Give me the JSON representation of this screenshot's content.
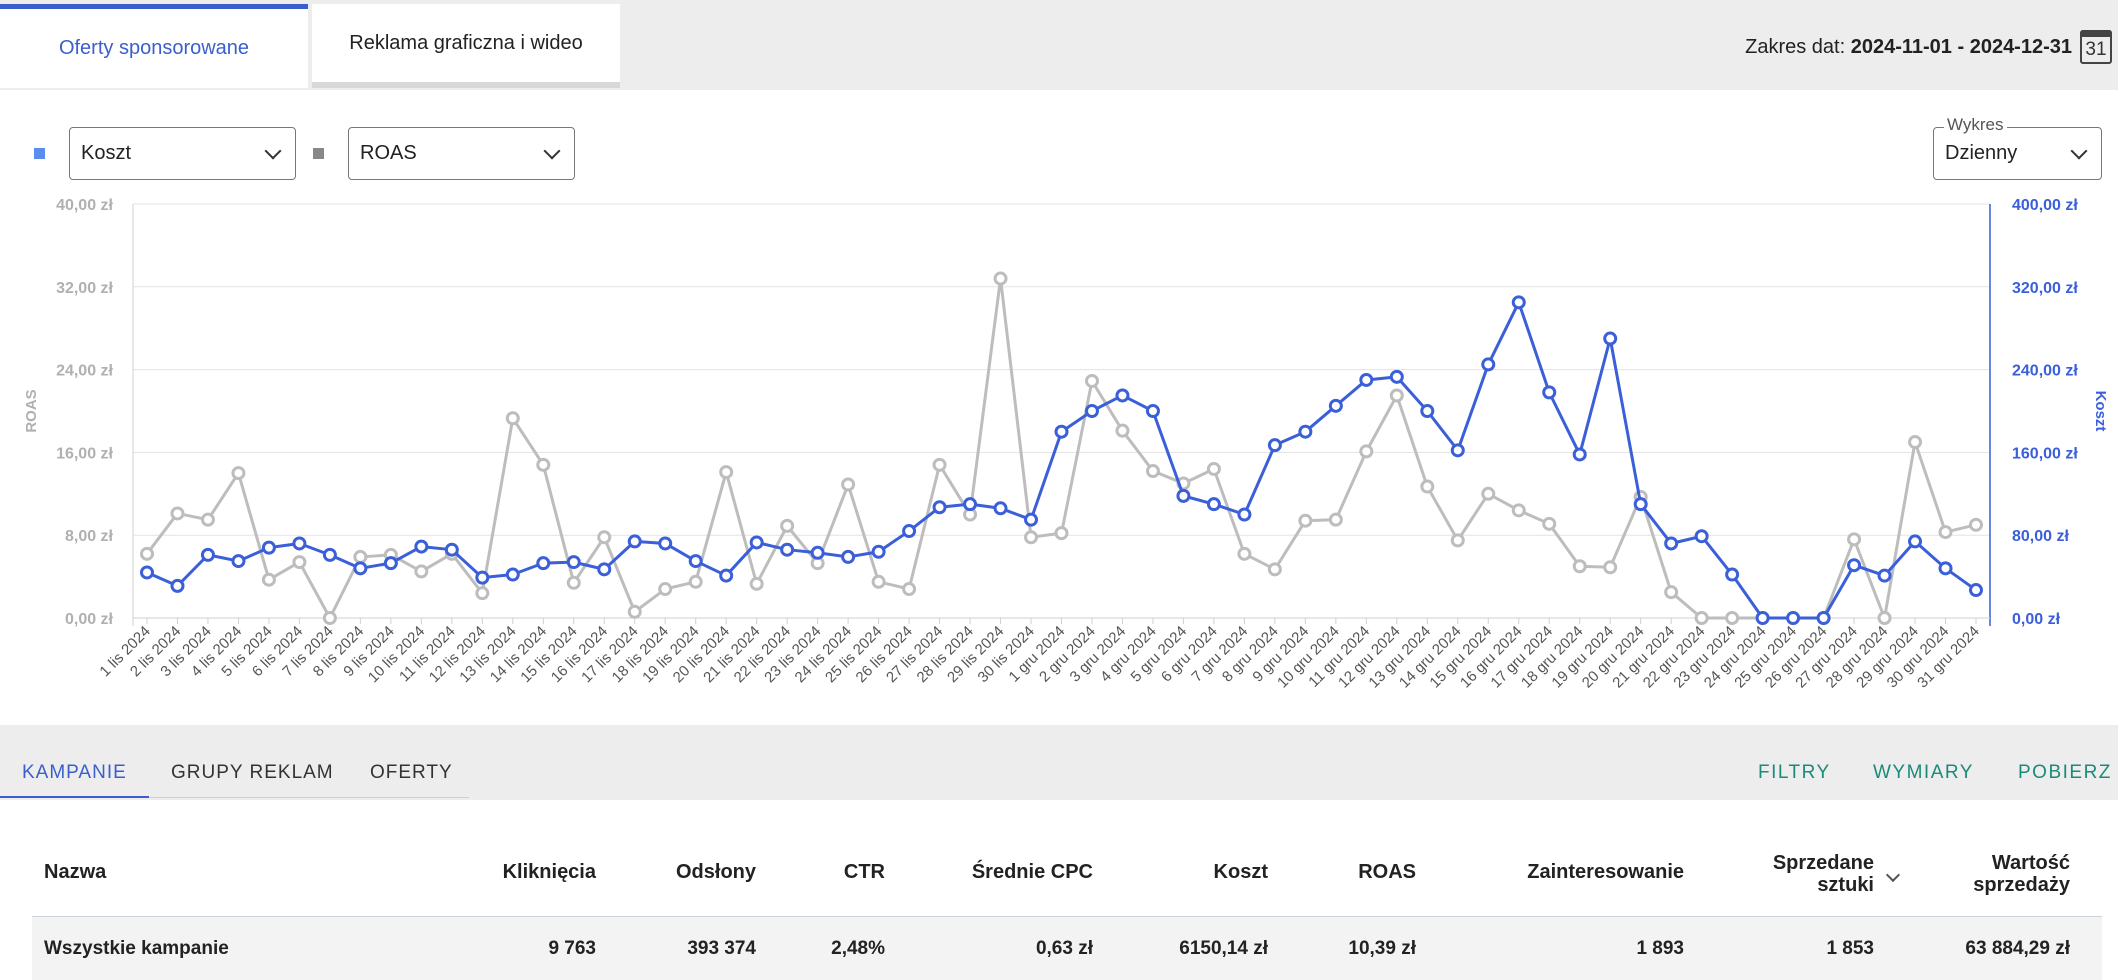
{
  "tabs": [
    {
      "label": "Oferty sponsorowane",
      "active": true
    },
    {
      "label": "Reklama graficzna i wideo",
      "active": false
    }
  ],
  "date_range": {
    "label": "Zakres dat:",
    "value": "2024-11-01 - 2024-12-31",
    "calendar_day": "31"
  },
  "selectors": {
    "left": "Koszt",
    "right": "ROAS",
    "chart_label": "Wykres",
    "chart_value": "Dzienny"
  },
  "colors": {
    "koszt": "#3a5fd9",
    "roas": "#bdbdbd",
    "accent": "#3a5fcd",
    "action": "#1a8a7a"
  },
  "chart_data": {
    "type": "line",
    "x": [
      "1 lis 2024",
      "2 lis 2024",
      "3 lis 2024",
      "4 lis 2024",
      "5 lis 2024",
      "6 lis 2024",
      "7 lis 2024",
      "8 lis 2024",
      "9 lis 2024",
      "10 lis 2024",
      "11 lis 2024",
      "12 lis 2024",
      "13 lis 2024",
      "14 lis 2024",
      "15 lis 2024",
      "16 lis 2024",
      "17 lis 2024",
      "18 lis 2024",
      "19 lis 2024",
      "20 lis 2024",
      "21 lis 2024",
      "22 lis 2024",
      "23 lis 2024",
      "24 lis 2024",
      "25 lis 2024",
      "26 lis 2024",
      "27 lis 2024",
      "28 lis 2024",
      "29 lis 2024",
      "30 lis 2024",
      "1 gru 2024",
      "2 gru 2024",
      "3 gru 2024",
      "4 gru 2024",
      "5 gru 2024",
      "6 gru 2024",
      "7 gru 2024",
      "8 gru 2024",
      "9 gru 2024",
      "10 gru 2024",
      "11 gru 2024",
      "12 gru 2024",
      "13 gru 2024",
      "14 gru 2024",
      "15 gru 2024",
      "16 gru 2024",
      "17 gru 2024",
      "18 gru 2024",
      "19 gru 2024",
      "20 gru 2024",
      "21 gru 2024",
      "22 gru 2024",
      "23 gru 2024",
      "24 gru 2024",
      "25 gru 2024",
      "26 gru 2024",
      "27 gru 2024",
      "28 gru 2024",
      "29 gru 2024",
      "30 gru 2024",
      "31 gru 2024"
    ],
    "series": [
      {
        "name": "ROAS",
        "axis": "left",
        "values": [
          6.2,
          10.1,
          9.5,
          14.0,
          3.7,
          5.4,
          0.0,
          5.9,
          6.1,
          4.5,
          6.2,
          2.4,
          19.3,
          14.8,
          3.4,
          7.8,
          0.6,
          2.8,
          3.5,
          14.1,
          3.3,
          8.9,
          5.3,
          12.9,
          3.5,
          2.8,
          14.8,
          10.0,
          32.8,
          7.8,
          8.2,
          22.9,
          18.1,
          14.2,
          13.0,
          14.4,
          6.2,
          4.7,
          9.4,
          9.5,
          16.1,
          21.5,
          12.7,
          7.5,
          12.0,
          10.4,
          9.1,
          5.0,
          4.9,
          11.7,
          2.5,
          0.0,
          0.0,
          0.0,
          0.0,
          0.0,
          7.6,
          0.0,
          17.0,
          8.3,
          9.0
        ]
      },
      {
        "name": "Koszt",
        "axis": "right",
        "values": [
          44,
          31,
          61,
          55,
          68,
          72,
          61,
          48,
          53,
          69,
          66,
          39,
          42,
          53,
          54,
          47,
          74,
          72,
          55,
          41,
          73,
          66,
          63,
          59,
          64,
          84,
          107,
          110,
          106,
          95,
          180,
          200,
          215,
          200,
          118,
          110,
          100,
          167,
          180,
          205,
          230,
          233,
          200,
          162,
          245,
          305,
          218,
          158,
          270,
          110,
          72,
          79,
          42,
          0,
          0,
          0,
          51,
          41,
          74,
          48,
          27
        ]
      }
    ],
    "left_axis": {
      "label": "ROAS",
      "range": [
        0,
        40
      ],
      "ticks": [
        "0,00 zł",
        "8,00 zł",
        "16,00 zł",
        "24,00 zł",
        "32,00 zł",
        "40,00 zł"
      ]
    },
    "right_axis": {
      "label": "Koszt",
      "range": [
        0,
        400
      ],
      "ticks": [
        "0,00 zł",
        "80,00 zł",
        "160,00 zł",
        "240,00 zł",
        "320,00 zł",
        "400,00 zł"
      ]
    },
    "grid": true
  },
  "bottom_tabs": [
    "KAMPANIE",
    "GRUPY REKLAM",
    "OFERTY"
  ],
  "actions": [
    "FILTRY",
    "WYMIARY",
    "POBIERZ"
  ],
  "table": {
    "headers": {
      "name": "Nazwa",
      "clicks": "Kliknięcia",
      "views": "Odsłony",
      "ctr": "CTR",
      "cpc": "Średnie CPC",
      "cost": "Koszt",
      "roas": "ROAS",
      "interest": "Zainteresowanie",
      "sold_1": "Sprzedane",
      "sold_2": "sztuki",
      "value_1": "Wartość",
      "value_2": "sprzedaży"
    },
    "row": {
      "name": "Wszystkie kampanie",
      "clicks": "9 763",
      "views": "393 374",
      "ctr": "2,48%",
      "cpc": "0,63 zł",
      "cost": "6150,14 zł",
      "roas": "10,39 zł",
      "interest": "1 893",
      "sold": "1 853",
      "value": "63 884,29 zł"
    }
  }
}
